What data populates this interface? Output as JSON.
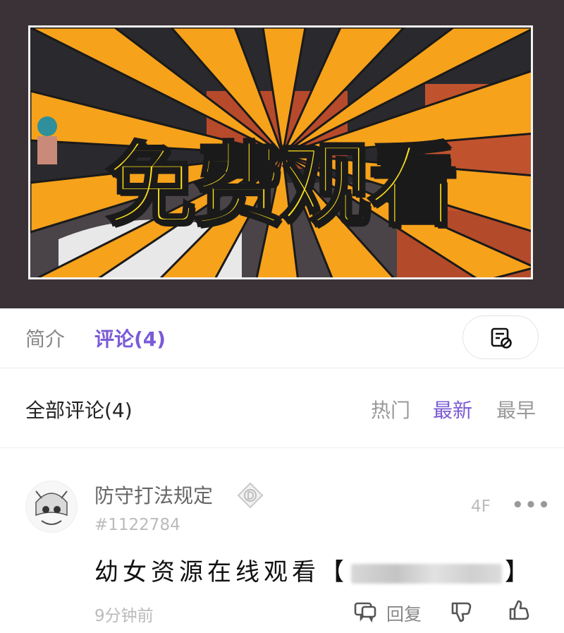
{
  "video": {
    "cover_title": "免费观看"
  },
  "tabs": {
    "intro_label": "简介",
    "comments_label": "评论(4)",
    "danmaku_icon": "danmaku-off-icon"
  },
  "comments_header": {
    "all_label": "全部评论(4)",
    "sort_hot": "热门",
    "sort_newest": "最新",
    "sort_oldest": "最早"
  },
  "comments": [
    {
      "username": "防守打法规定",
      "uid": "#1122784",
      "floor": "4F",
      "more_label": "•••",
      "content_prefix": "幼女资源在线观看【",
      "content_suffix": "】",
      "time": "9分钟前",
      "reply_label": "回复"
    }
  ],
  "colors": {
    "accent": "#7b5bd6",
    "cover_text": "#ffe21a",
    "cover_rays": "#f7a21b"
  }
}
